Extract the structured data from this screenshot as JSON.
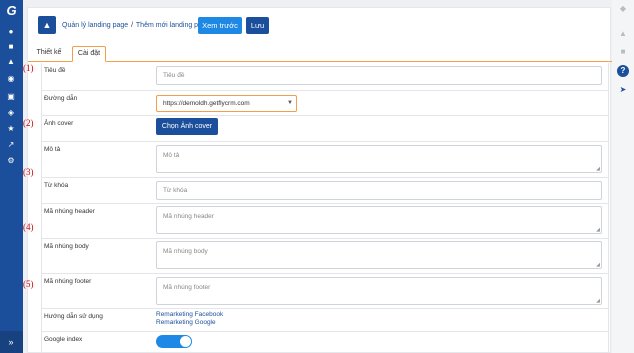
{
  "sidebar": {
    "logo": "G",
    "icons": [
      "user-icon",
      "briefcase-icon",
      "team-icon",
      "target-icon",
      "cart-icon",
      "network-icon",
      "star-icon",
      "chart-icon",
      "gear-icon"
    ],
    "expand": "»"
  },
  "rightbar": {
    "icons": [
      "tag-icon",
      "bell-icon",
      "chat-icon",
      "help-icon",
      "rocket-icon"
    ]
  },
  "toolbar": {
    "breadcrumb_parent": "Quản lý landing page",
    "breadcrumb_sep": "/",
    "breadcrumb_current": "Thêm mới landing page",
    "preview_label": "Xem trước",
    "save_label": "Lưu"
  },
  "tabs": {
    "design": "Thiết kế",
    "settings": "Cài đặt"
  },
  "form": {
    "title": {
      "label": "Tiêu đề",
      "placeholder": "Tiêu đề"
    },
    "path": {
      "label": "Đường dẫn",
      "value": "https://demoldh.getflycrm.com"
    },
    "cover": {
      "label": "Ảnh cover",
      "button": "Chọn Ảnh cover"
    },
    "description": {
      "label": "Mô tả",
      "placeholder": "Mô tả"
    },
    "keywords": {
      "label": "Từ khóa",
      "placeholder": "Từ khóa"
    },
    "header_code": {
      "label": "Mã nhúng header",
      "placeholder": "Mã nhúng header"
    },
    "body_code": {
      "label": "Mã nhúng body",
      "placeholder": "Mã nhúng body"
    },
    "footer_code": {
      "label": "Mã nhúng footer",
      "placeholder": "Mã nhúng footer"
    },
    "guide": {
      "label": "Hướng dẫn sử dụng",
      "link1": "Remarketing Facebook",
      "link2": "Remarketing Google"
    },
    "google_index": {
      "label": "Google index",
      "enabled": true
    }
  },
  "annotations": [
    "(1)",
    "(2)",
    "(3)",
    "(4)",
    "(5)"
  ]
}
